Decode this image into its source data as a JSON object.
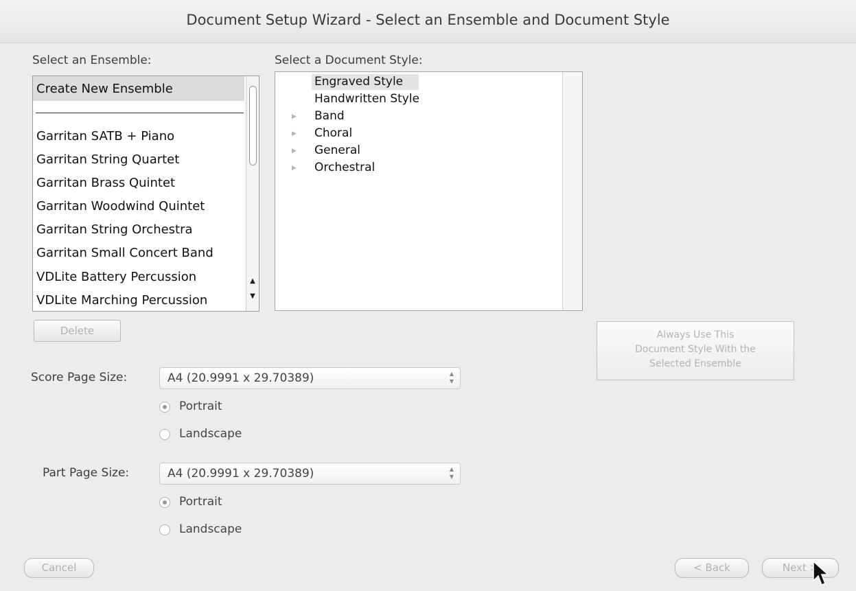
{
  "window": {
    "title": "Document Setup Wizard - Select an Ensemble and Document Style"
  },
  "ensemble": {
    "label": "Select an Ensemble:",
    "create_new": "Create New Ensemble",
    "items": [
      "Garritan SATB + Piano",
      "Garritan String Quartet",
      "Garritan Brass Quintet",
      "Garritan Woodwind Quintet",
      "Garritan String Orchestra",
      "Garritan Small Concert Band",
      "VDLite Battery Percussion",
      "VDLite Marching Percussion"
    ],
    "delete_label": "Delete"
  },
  "style": {
    "label": "Select a Document Style:",
    "items": [
      {
        "label": "Engraved Style",
        "expandable": false,
        "selected": true
      },
      {
        "label": "Handwritten Style",
        "expandable": false,
        "selected": false
      },
      {
        "label": "Band",
        "expandable": true,
        "selected": false
      },
      {
        "label": "Choral",
        "expandable": true,
        "selected": false
      },
      {
        "label": "General",
        "expandable": true,
        "selected": false
      },
      {
        "label": "Orchestral",
        "expandable": true,
        "selected": false
      }
    ]
  },
  "always_use": {
    "line1": "Always Use This",
    "line2": "Document Style With the",
    "line3": "Selected Ensemble"
  },
  "score_page": {
    "label": "Score Page Size:",
    "value": "A4 (20.9991 x 29.70389)",
    "portrait": "Portrait",
    "landscape": "Landscape",
    "orientation": "Portrait"
  },
  "part_page": {
    "label": "Part Page Size:",
    "value": "A4 (20.9991 x 29.70389)",
    "portrait": "Portrait",
    "landscape": "Landscape",
    "orientation": "Portrait"
  },
  "footer": {
    "cancel": "Cancel",
    "back": "< Back",
    "next": "Next >"
  },
  "colors": {
    "window_bg": "#ececec",
    "disabled_text": "#b2b2b2",
    "selection": "#dcdcdc"
  }
}
